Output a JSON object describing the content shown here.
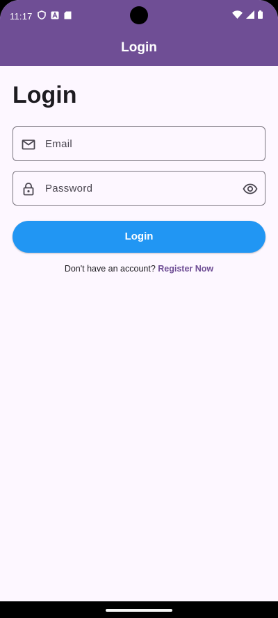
{
  "status_bar": {
    "time": "11:17",
    "icons_left": [
      "shield-icon",
      "a-badge-icon",
      "sd-card-icon"
    ],
    "icons_right": [
      "wifi-icon",
      "signal-icon",
      "battery-icon"
    ]
  },
  "app_bar": {
    "title": "Login"
  },
  "form": {
    "heading": "Login",
    "email": {
      "label": "Email",
      "icon": "mail-icon"
    },
    "password": {
      "label": "Password",
      "icon": "lock-icon",
      "trailing_icon": "eye-icon"
    },
    "submit_label": "Login",
    "register_prompt": "Don't have an account?",
    "register_link": "Register Now"
  },
  "colors": {
    "app_bar": "#6f4e95",
    "background": "#fdf7ff",
    "button": "#2196f3",
    "link": "#6f4e95"
  }
}
